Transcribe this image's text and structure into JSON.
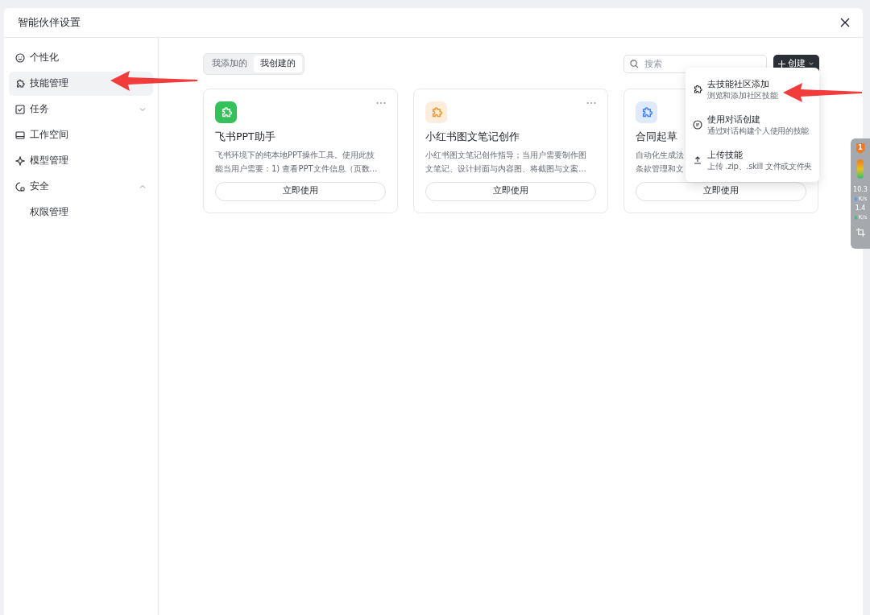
{
  "window": {
    "title": "智能伙伴设置"
  },
  "sidebar": {
    "items": [
      {
        "label": "个性化",
        "selected": false
      },
      {
        "label": "技能管理",
        "selected": true
      },
      {
        "label": "任务",
        "selected": false,
        "expanded": false
      },
      {
        "label": "工作空间",
        "selected": false
      },
      {
        "label": "模型管理",
        "selected": false
      },
      {
        "label": "安全",
        "selected": false,
        "expanded": true,
        "children": [
          {
            "label": "权限管理",
            "selected": false
          }
        ]
      }
    ]
  },
  "tabs": [
    {
      "label": "我添加的",
      "selected": false
    },
    {
      "label": "我创建的",
      "selected": true
    }
  ],
  "search": {
    "placeholder": "搜索"
  },
  "create_button": {
    "label": "创建"
  },
  "cards": [
    {
      "title": "飞书PPT助手",
      "description_lines": [
        "飞书环境下的纯本地PPT操作工具。使用此技",
        "能当用户需要：1) 查看PPT文件信息（页数…"
      ],
      "kind": "solid",
      "color": "#34c05a",
      "button": "立即使用"
    },
    {
      "title": "小红书图文笔记创作",
      "description_lines": [
        "小红书图文笔记创作指导；当用户需要制作图",
        "文笔记、设计封面与内容图、将截图与文案…"
      ],
      "kind": "soft",
      "color": "#f5922e",
      "button": "立即使用"
    },
    {
      "title": "合同起草",
      "description_lines": [
        "自动化生成法",
        "条款管理和文"
      ],
      "kind": "soft",
      "color": "#3b7ff5",
      "button": "立即使用"
    }
  ],
  "create_menu": [
    {
      "title": "去技能社区添加",
      "subtitle": "浏览和添加社区技能"
    },
    {
      "title": "使用对话创建",
      "subtitle": "通过对话构建个人使用的技能"
    },
    {
      "title": "上传技能",
      "subtitle": "上传 .zip、.skill 文件或文件夹"
    }
  ],
  "monitor_widget": {
    "badge": "1",
    "upload": "10.3",
    "upload_unit": "K/s",
    "download": "1.4",
    "download_unit": "K/s"
  }
}
